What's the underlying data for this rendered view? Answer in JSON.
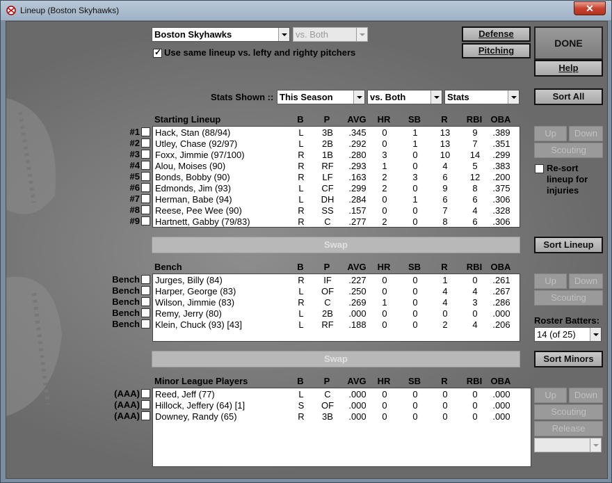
{
  "window": {
    "title": "Lineup (Boston Skyhawks)",
    "close_glyph": "✕"
  },
  "team_select": {
    "value": "Boston Skyhawks"
  },
  "vs_select_top": {
    "value": "vs. Both"
  },
  "same_lineup": {
    "label": "Use same lineup vs. lefty and righty pitchers",
    "checked": true
  },
  "buttons": {
    "defense": "Defense",
    "pitching": "Pitching",
    "done": "DONE",
    "help": "Help",
    "sort_all": "Sort All",
    "sort_lineup": "Sort Lineup",
    "sort_minors": "Sort Minors",
    "up": "Up",
    "down": "Down",
    "scouting": "Scouting",
    "release": "Release",
    "swap": "Swap"
  },
  "stats_bar": {
    "label": "Stats Shown ::",
    "season": "This Season",
    "vs": "vs. Both",
    "stats": "Stats"
  },
  "resort": {
    "label": "Re-sort lineup for injuries",
    "checked": false
  },
  "roster_batters": {
    "label": "Roster Batters:",
    "value": "14 (of 25)"
  },
  "columns": [
    "B",
    "P",
    "AVG",
    "HR",
    "SB",
    "R",
    "RBI",
    "OBA"
  ],
  "starting": {
    "title": "Starting Lineup",
    "rows": [
      {
        "slot": "#1",
        "name": "Hack, Stan (88/94)",
        "b": "L",
        "p": "3B",
        "avg": ".345",
        "hr": "0",
        "sb": "1",
        "r": "13",
        "rbi": "9",
        "oba": ".389"
      },
      {
        "slot": "#2",
        "name": "Utley, Chase (92/97)",
        "b": "L",
        "p": "2B",
        "avg": ".292",
        "hr": "0",
        "sb": "1",
        "r": "13",
        "rbi": "7",
        "oba": ".351"
      },
      {
        "slot": "#3",
        "name": "Foxx, Jimmie (97/100)",
        "b": "R",
        "p": "1B",
        "avg": ".280",
        "hr": "3",
        "sb": "0",
        "r": "10",
        "rbi": "14",
        "oba": ".299"
      },
      {
        "slot": "#4",
        "name": "Alou, Moises (90)",
        "b": "R",
        "p": "RF",
        "avg": ".293",
        "hr": "1",
        "sb": "0",
        "r": "4",
        "rbi": "5",
        "oba": ".383"
      },
      {
        "slot": "#5",
        "name": "Bonds, Bobby (90)",
        "b": "R",
        "p": "LF",
        "avg": ".163",
        "hr": "2",
        "sb": "3",
        "r": "6",
        "rbi": "12",
        "oba": ".200"
      },
      {
        "slot": "#6",
        "name": "Edmonds, Jim (93)",
        "b": "L",
        "p": "CF",
        "avg": ".299",
        "hr": "2",
        "sb": "0",
        "r": "9",
        "rbi": "8",
        "oba": ".375"
      },
      {
        "slot": "#7",
        "name": "Herman, Babe (94)",
        "b": "L",
        "p": "DH",
        "avg": ".284",
        "hr": "0",
        "sb": "1",
        "r": "6",
        "rbi": "6",
        "oba": ".306"
      },
      {
        "slot": "#8",
        "name": "Reese, Pee Wee (90)",
        "b": "R",
        "p": "SS",
        "avg": ".157",
        "hr": "0",
        "sb": "0",
        "r": "7",
        "rbi": "4",
        "oba": ".328"
      },
      {
        "slot": "#9",
        "name": "Hartnett, Gabby (79/83)",
        "b": "R",
        "p": "C",
        "avg": ".277",
        "hr": "2",
        "sb": "0",
        "r": "8",
        "rbi": "6",
        "oba": ".306"
      }
    ]
  },
  "bench": {
    "title": "Bench",
    "rows": [
      {
        "slot": "Bench",
        "name": "Jurges, Billy (84)",
        "b": "R",
        "p": "IF",
        "avg": ".227",
        "hr": "0",
        "sb": "0",
        "r": "1",
        "rbi": "0",
        "oba": ".261"
      },
      {
        "slot": "Bench",
        "name": "Harper, George (83)",
        "b": "L",
        "p": "OF",
        "avg": ".250",
        "hr": "0",
        "sb": "0",
        "r": "4",
        "rbi": "4",
        "oba": ".267"
      },
      {
        "slot": "Bench",
        "name": "Wilson, Jimmie (83)",
        "b": "R",
        "p": "C",
        "avg": ".269",
        "hr": "1",
        "sb": "0",
        "r": "4",
        "rbi": "3",
        "oba": ".286"
      },
      {
        "slot": "Bench",
        "name": "Remy, Jerry (80)",
        "b": "L",
        "p": "2B",
        "avg": ".000",
        "hr": "0",
        "sb": "0",
        "r": "0",
        "rbi": "0",
        "oba": ".000"
      },
      {
        "slot": "Bench",
        "name": "Klein, Chuck (93) [43]",
        "b": "L",
        "p": "RF",
        "avg": ".188",
        "hr": "0",
        "sb": "0",
        "r": "2",
        "rbi": "4",
        "oba": ".206"
      }
    ]
  },
  "minors": {
    "title": "Minor League Players",
    "rows": [
      {
        "slot": "(AAA)",
        "name": "Reed, Jeff (77)",
        "b": "L",
        "p": "C",
        "avg": ".000",
        "hr": "0",
        "sb": "0",
        "r": "0",
        "rbi": "0",
        "oba": ".000"
      },
      {
        "slot": "(AAA)",
        "name": "Hillock, Jeffery (64) [1]",
        "b": "S",
        "p": "OF",
        "avg": ".000",
        "hr": "0",
        "sb": "0",
        "r": "0",
        "rbi": "0",
        "oba": ".000"
      },
      {
        "slot": "(AAA)",
        "name": "Downey, Randy (65)",
        "b": "R",
        "p": "3B",
        "avg": ".000",
        "hr": "0",
        "sb": "0",
        "r": "0",
        "rbi": "0",
        "oba": ".000"
      }
    ]
  }
}
